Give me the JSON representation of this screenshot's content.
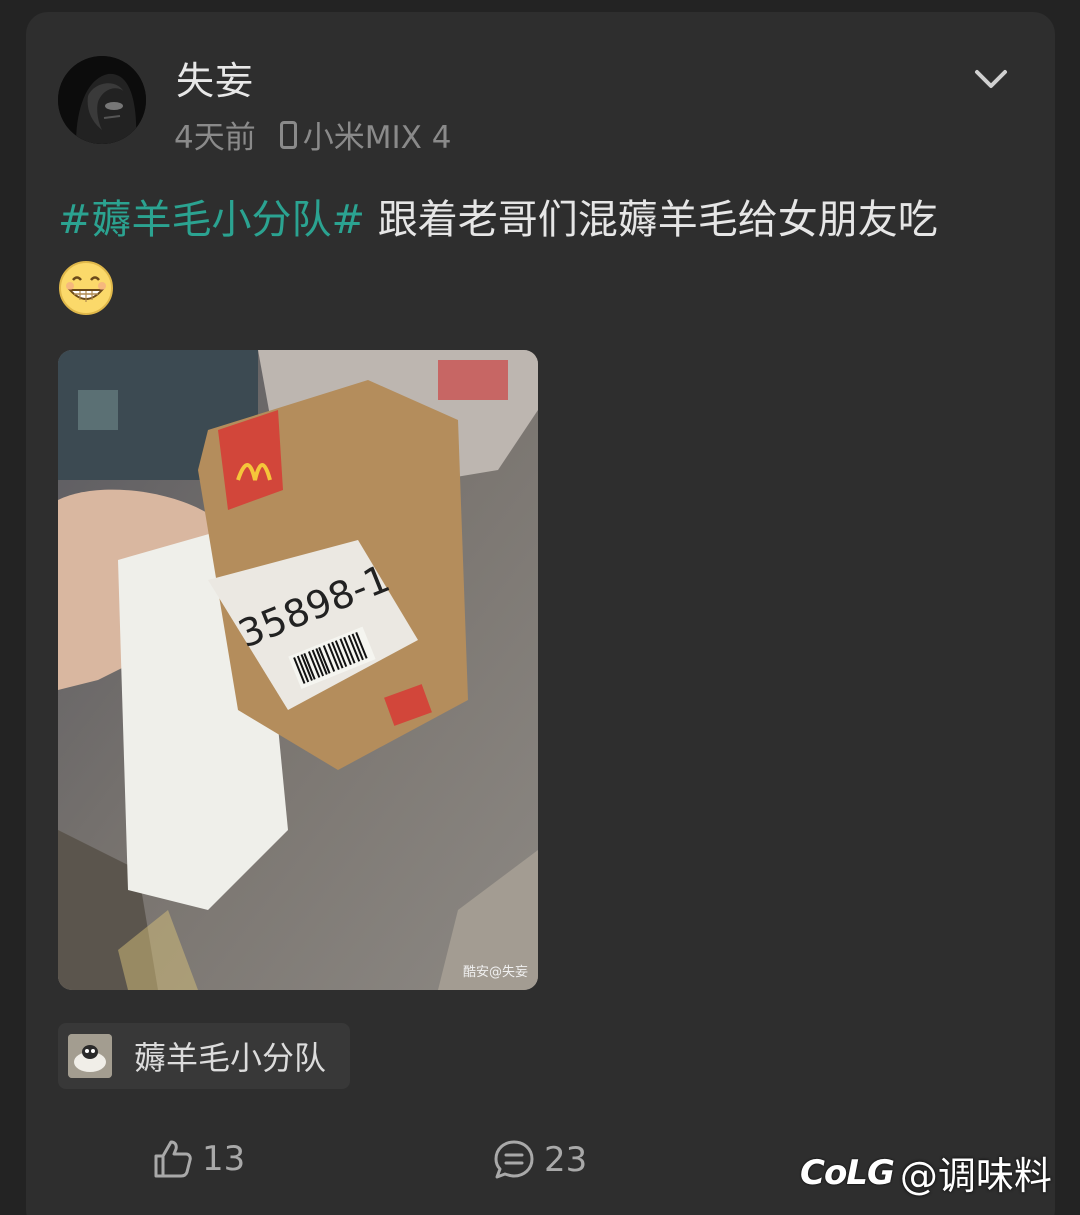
{
  "post": {
    "author": "失妄",
    "time": "4天前",
    "device": "小米MIX 4",
    "hashtag": "#薅羊毛小分队#",
    "text": " 跟着老哥们混薅羊毛给女朋友吃",
    "emoji": "grinning-face-emoji",
    "image": {
      "order_number": "35898-1",
      "watermark": "酷安@失妄"
    },
    "topic_chip": "薅羊毛小分队"
  },
  "actions": {
    "likes": "13",
    "comments": "23"
  },
  "watermark": {
    "logo": "CoLG",
    "handle": "@调味料"
  },
  "colors": {
    "hashtag": "#2ba391",
    "background": "#232323",
    "card": "#2e2e2e"
  }
}
